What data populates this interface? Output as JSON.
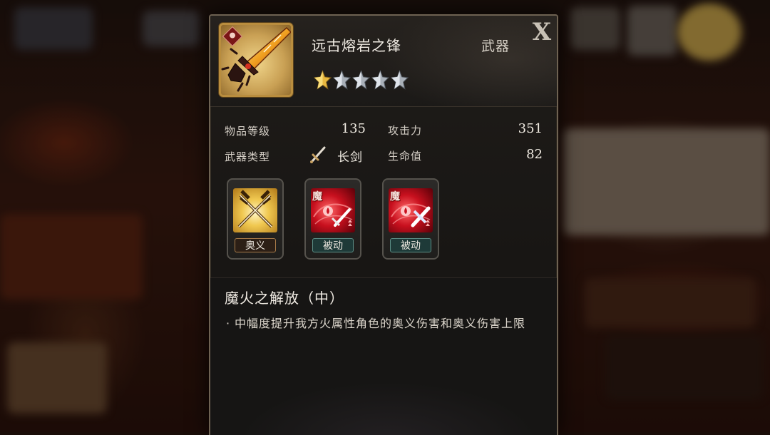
{
  "item": {
    "name": "远古熔岩之锋",
    "category": "武器",
    "stars_filled": 1,
    "stars_total": 5,
    "icon": "flame-sword-icon"
  },
  "close_label": "X",
  "stats": {
    "item_level_label": "物品等级",
    "item_level_value": "135",
    "attack_label": "攻击力",
    "attack_value": "351",
    "weapon_type_label": "武器类型",
    "weapon_type_value": "长剑",
    "hp_label": "生命值",
    "hp_value": "82"
  },
  "skills": [
    {
      "tag": "奥义",
      "icon": "crossed-swords-icon",
      "kind": "ougi"
    },
    {
      "tag": "被动",
      "icon": "fire-sword-passive-icon",
      "kind": "passive",
      "badge": "魔"
    },
    {
      "tag": "被动",
      "icon": "fire-sword-passive-icon",
      "kind": "passive",
      "badge": "魔"
    }
  ],
  "description": {
    "title": "魔火之解放（中）",
    "bullet": "·",
    "text": "中幅度提升我方火属性角色的奥义伤害和奥义伤害上限"
  },
  "colors": {
    "panel_border": "#6e6252",
    "gold_frame": "#b98d3e",
    "passive_tag": "#1e3a38",
    "fire_red": "#b0101e"
  }
}
